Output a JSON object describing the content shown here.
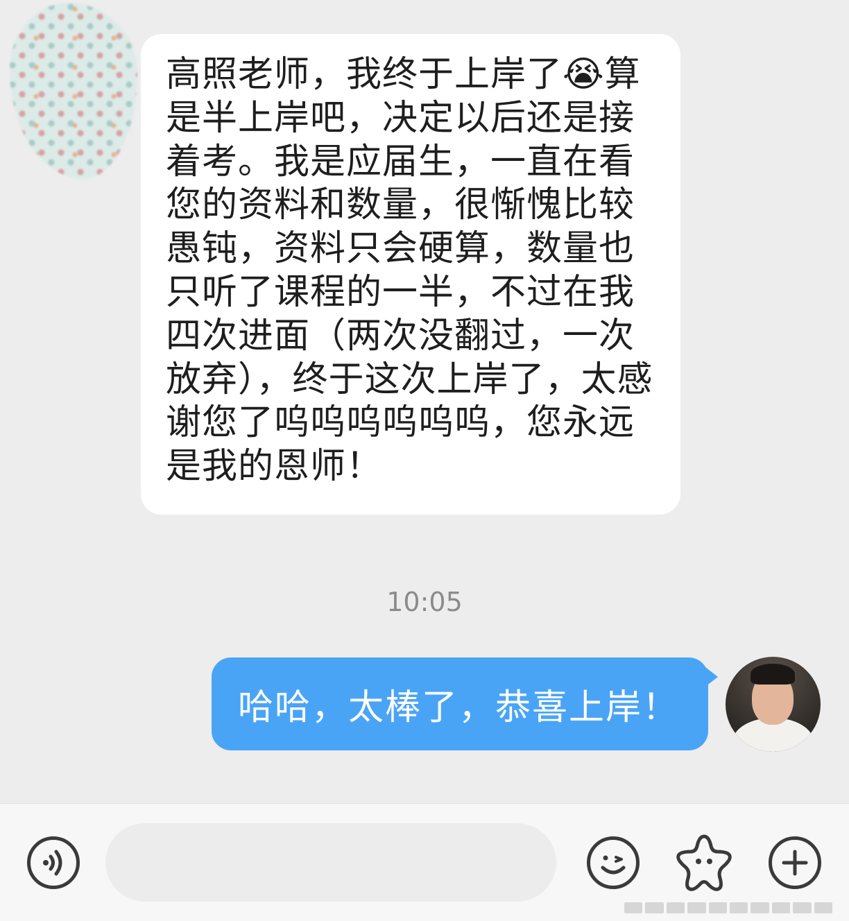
{
  "conversation": {
    "incoming_message": {
      "text": "高照老师，我终于上岸了😭算是半上岸吧，决定以后还是接着考。我是应届生，一直在看您的资料和数量，很惭愧比较愚钝，资料只会硬算，数量也只听了课程的一半，不过在我四次进面（两次没翻过，一次放弃），终于这次上岸了，太感谢您了呜呜呜呜呜呜，您永远是我的恩师！"
    },
    "timestamp": "10:05",
    "outgoing_message": {
      "text": "哈哈，太棒了，恭喜上岸！"
    }
  },
  "input_bar": {
    "message_input_value": "",
    "icons": [
      "voice-icon",
      "emoji-icon",
      "sticker-icon",
      "plus-icon"
    ]
  },
  "colors": {
    "background": "#ededed",
    "incoming_bubble": "#ffffff",
    "outgoing_bubble": "#4aa4f6",
    "timestamp": "#8b8b8b",
    "icon_stroke": "#3a3a3a"
  }
}
